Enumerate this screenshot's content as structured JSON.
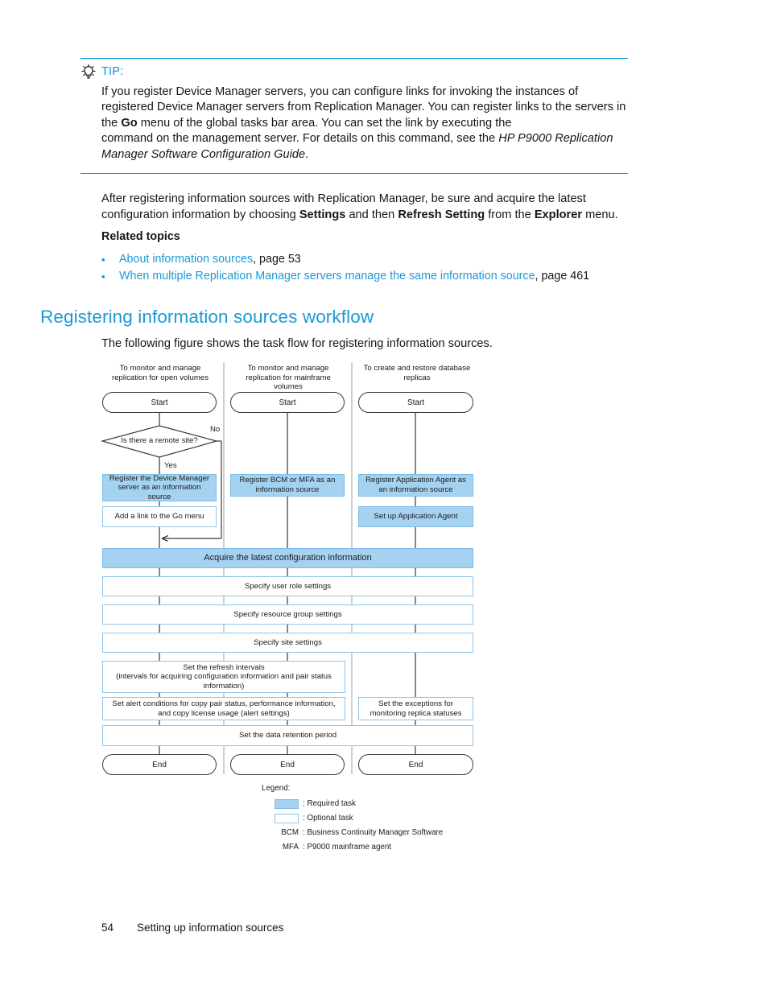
{
  "tip": {
    "icon": "lightbulb-icon",
    "label": "TIP:",
    "line1": "If you register Device Manager servers, you can configure links for invoking the instances of registered",
    "line2a": "Device Manager servers from Replication Manager. You can register links to the servers in the ",
    "line2b": "Go",
    "line3a": "menu of the global tasks bar area. You can set the link by executing the",
    "line3b": "command on",
    "line4a": "the management server. For details on this command, see the ",
    "line4b": "HP P9000 Replication Manager Software",
    "line5": "Configuration Guide",
    "line5end": "."
  },
  "body": {
    "after_line1": "After registering information sources with Replication Manager, be sure and acquire the latest",
    "after_line2a": "configuration information by choosing ",
    "after_bold1": "Settings",
    "after_line2b": " and then ",
    "after_bold2": "Refresh Setting",
    "after_line2c": " from the ",
    "after_bold3": "Explorer",
    "after_line2d": " menu.",
    "related_topics": "Related topics",
    "bullets": [
      {
        "link": "About information sources",
        "suffix": ", page 53"
      },
      {
        "link": "When multiple Replication Manager servers manage the same information source",
        "suffix": ", page 461"
      }
    ]
  },
  "section": {
    "heading": "Registering information sources workflow",
    "intro": "The following figure shows the task flow for registering information sources."
  },
  "flowchart": {
    "columns": [
      {
        "header": "To monitor and manage\nreplication for open volumes",
        "start": "Start",
        "end": "End"
      },
      {
        "header": "To monitor and manage\nreplication for mainframe\nvolumes",
        "start": "Start",
        "end": "End"
      },
      {
        "header": "To create and restore database\nreplicas",
        "start": "Start",
        "end": "End"
      }
    ],
    "decision": "Is there a remote site?",
    "branch_yes": "Yes",
    "branch_no": "No",
    "col1_register": "Register the Device Manager\nserver as an information\nsource",
    "col1_golink": "Add a link to the Go menu",
    "col2_register": "Register BCM or MFA as an\ninformation source",
    "col3_register": "Register Application Agent as\nan information source",
    "col3_setup": "Set up Application Agent",
    "acquire": "Acquire the latest configuration information",
    "user_role": "Specify user role settings",
    "resource_group": "Specify resource group settings",
    "site_settings": "Specify site settings",
    "refresh_intervals": "Set the refresh intervals\n(intervals for acquiring configuration information and pair status\ninformation)",
    "alert_conditions": "Set alert conditions for copy pair status, performance information,\nand copy license usage (alert settings)",
    "exceptions": "Set the exceptions for\nmonitoring replica statuses",
    "retention": "Set the data retention period"
  },
  "legend": {
    "title": "Legend:",
    "rows": [
      {
        "key": "",
        "swatch": "required",
        "text": ": Required task"
      },
      {
        "key": "",
        "swatch": "optional",
        "text": ": Optional task"
      },
      {
        "key": "BCM",
        "swatch": "",
        "text": ": Business Continuity Manager Software"
      },
      {
        "key": "MFA",
        "swatch": "",
        "text": ": P9000 mainframe agent"
      }
    ]
  },
  "footer": {
    "page": "54",
    "title": "Setting up information sources"
  },
  "colors": {
    "accent": "#0096d6",
    "link": "#1b9ad6",
    "required_fill": "#a6d2f2",
    "box_border": "#8ec4ea"
  }
}
